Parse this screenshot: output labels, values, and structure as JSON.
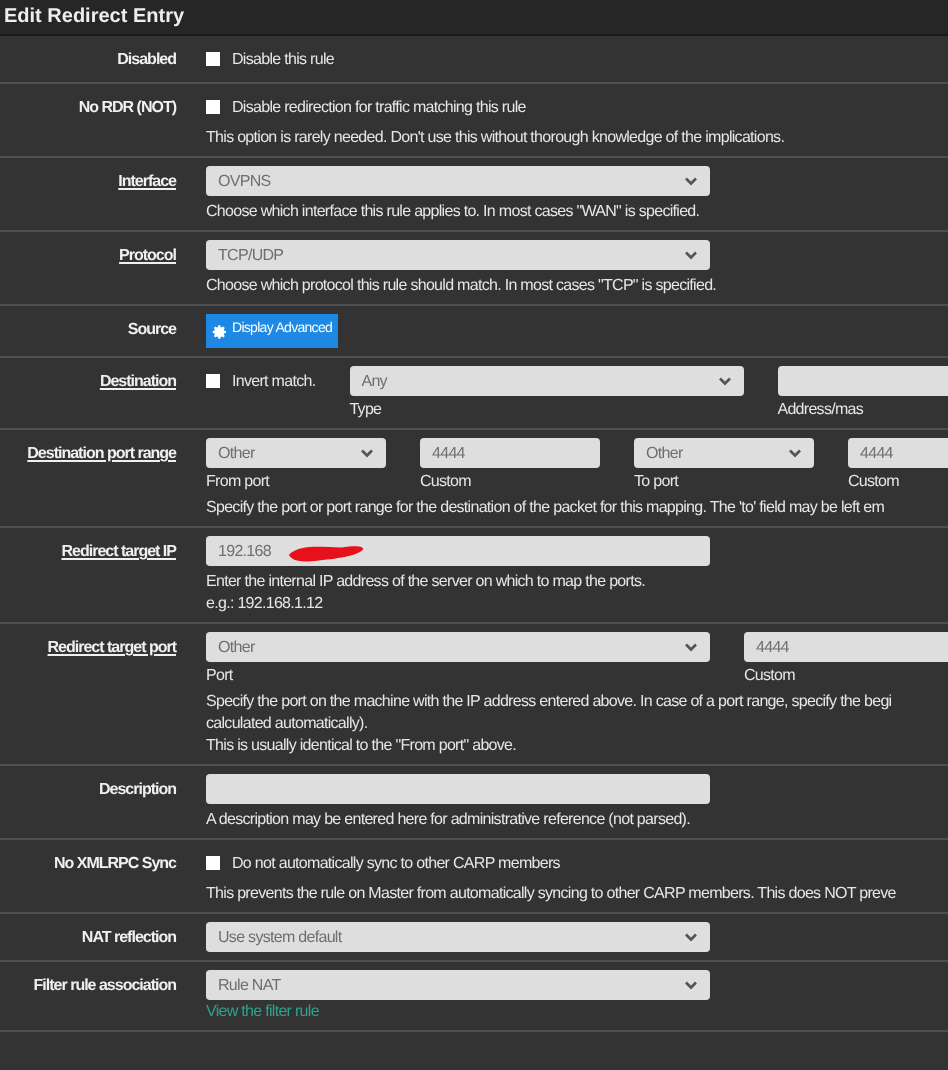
{
  "title": "Edit Redirect Entry",
  "rows": [
    {
      "label": "Disabled",
      "link": false,
      "items": [
        {
          "kind": "checkbox",
          "label": "Disable this rule",
          "checked": false
        }
      ],
      "help": []
    },
    {
      "label": "No RDR (NOT)",
      "link": false,
      "items": [
        {
          "kind": "checkbox",
          "label": "Disable redirection for traffic matching this rule",
          "checked": false
        }
      ],
      "help": [
        "This option is rarely needed. Don't use this without thorough knowledge of the implications."
      ]
    },
    {
      "label": "Interface",
      "link": true,
      "items": [
        {
          "kind": "select",
          "value": "OVPNS"
        }
      ],
      "help": [
        "Choose which interface this rule applies to. In most cases \"WAN\" is specified."
      ]
    },
    {
      "label": "Protocol",
      "link": true,
      "items": [
        {
          "kind": "select",
          "value": "TCP/UDP"
        }
      ],
      "help": [
        "Choose which protocol this rule should match. In most cases \"TCP\" is specified."
      ]
    },
    {
      "label": "Source",
      "link": false,
      "items": [
        {
          "kind": "button",
          "label": "Display Advanced"
        }
      ],
      "help": []
    },
    {
      "label": "Destination",
      "link": true,
      "items": [
        {
          "kind": "checkbox",
          "label": "Invert match.",
          "checked": false
        },
        {
          "kind": "select",
          "value": "Any",
          "caption": "Type"
        },
        {
          "kind": "input",
          "value": "",
          "caption": "Address/mas"
        }
      ],
      "help": []
    },
    {
      "label": "Destination port range",
      "link": true,
      "items": [
        {
          "kind": "select",
          "value": "Other",
          "caption": "From port"
        },
        {
          "kind": "input",
          "value": "4444",
          "caption": "Custom"
        },
        {
          "kind": "select",
          "value": "Other",
          "caption": "To port"
        },
        {
          "kind": "input",
          "value": "4444",
          "caption": "Custom"
        }
      ],
      "help": [
        "Specify the port or port range for the destination of the packet for this mapping. The 'to' field may be left em"
      ]
    },
    {
      "label": "Redirect target IP",
      "link": true,
      "items": [
        {
          "kind": "input",
          "value": "192.168",
          "redacted": true
        }
      ],
      "help": [
        "Enter the internal IP address of the server on which to map the ports.",
        "e.g.: 192.168.1.12"
      ]
    },
    {
      "label": "Redirect target port",
      "link": true,
      "items": [
        {
          "kind": "select",
          "value": "Other",
          "caption": "Port"
        },
        {
          "kind": "input",
          "value": "4444",
          "caption": "Custom"
        }
      ],
      "help": [
        "Specify the port on the machine with the IP address entered above. In case of a port range, specify the begi",
        "calculated automatically).",
        "This is usually identical to the \"From port\" above."
      ]
    },
    {
      "label": "Description",
      "link": false,
      "items": [
        {
          "kind": "input",
          "value": ""
        }
      ],
      "help": [
        "A description may be entered here for administrative reference (not parsed)."
      ]
    },
    {
      "label": "No XMLRPC Sync",
      "link": false,
      "items": [
        {
          "kind": "checkbox",
          "label": "Do not automatically sync to other CARP members",
          "checked": false
        }
      ],
      "help": [
        "This prevents the rule on Master from automatically syncing to other CARP members. This does NOT preve"
      ]
    },
    {
      "label": "NAT reflection",
      "link": false,
      "items": [
        {
          "kind": "select",
          "value": "Use system default"
        }
      ],
      "help": []
    },
    {
      "label": "Filter rule association",
      "link": false,
      "items": [
        {
          "kind": "select",
          "value": "Rule NAT"
        }
      ],
      "help": [],
      "footer_link": "View the filter rule"
    }
  ]
}
